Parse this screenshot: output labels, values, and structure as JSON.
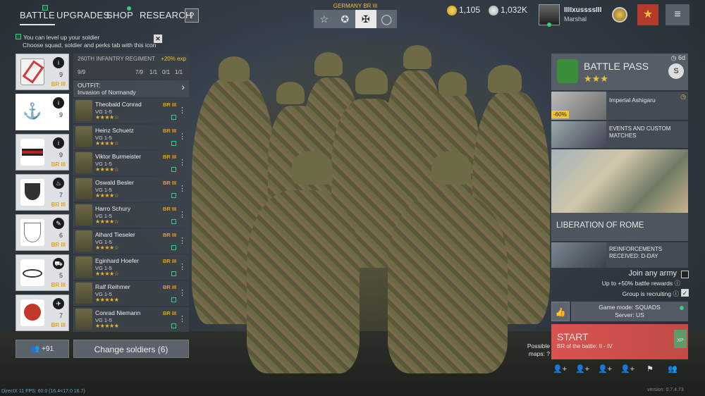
{
  "nav": {
    "tabs": [
      "BATTLE",
      "UPGRADES",
      "SHOP",
      "RESEARCH"
    ],
    "help": "?"
  },
  "nation": {
    "name": "GERMANY",
    "rank": "BR III",
    "icons": [
      "☆",
      "✪",
      "✠",
      "◯"
    ]
  },
  "currency": {
    "gold": "1,105",
    "silver": "1,032K"
  },
  "player": {
    "name": "IIIIxussssIII",
    "rank": "Marshal"
  },
  "hint": {
    "line1": "You can level up your soldier",
    "line2": "Choose squad, soldier and perks tab with this icon",
    "close": "✕"
  },
  "squads": [
    {
      "count": "9",
      "br": "BR III",
      "icon": "i",
      "color": "#d23b3b"
    },
    {
      "count": "9",
      "br": "",
      "icon": "i",
      "color": "#222"
    },
    {
      "count": "9",
      "br": "BR III",
      "icon": "i",
      "color": "#b22"
    },
    {
      "count": "7",
      "br": "BR III",
      "icon": "♨",
      "color": "#333"
    },
    {
      "count": "6",
      "br": "BR III",
      "icon": "✎",
      "color": "#777"
    },
    {
      "count": "5",
      "br": "BR III",
      "icon": "⛟",
      "color": "#555"
    },
    {
      "count": "7",
      "br": "BR III",
      "icon": "✈",
      "color": "#c0392b"
    }
  ],
  "regiment": {
    "title": "260TH INFANTRY REGIMENT",
    "exp": "+20% exp",
    "count": "9/9",
    "slots": [
      "7/9",
      "1/1",
      "0/1",
      "1/1"
    ]
  },
  "outfit": {
    "label": "OUTFIT:",
    "value": "Invasion of Normandy"
  },
  "soldiers": [
    {
      "name": "Theobald Conrad",
      "rank": "VG 1-5",
      "stars": "★★★★☆",
      "br": "BR III"
    },
    {
      "name": "Heinz Schuetz",
      "rank": "VG 1-5",
      "stars": "★★★★☆",
      "br": "BR III"
    },
    {
      "name": "Viktor Burmeister",
      "rank": "VG 1-5",
      "stars": "★★★★☆",
      "br": "BR III"
    },
    {
      "name": "Oswald Besler",
      "rank": "VG 1-5",
      "stars": "★★★★☆",
      "br": "BR III"
    },
    {
      "name": "Harro Schury",
      "rank": "VG 1-5",
      "stars": "★★★★☆",
      "br": "BR III"
    },
    {
      "name": "Alhard Tieseler",
      "rank": "VG 1-5",
      "stars": "★★★★☆",
      "br": "BR III"
    },
    {
      "name": "Eginhard Hoefer",
      "rank": "VG 1-5",
      "stars": "★★★★☆",
      "br": "BR III"
    },
    {
      "name": "Ralf Reihmer",
      "rank": "VG 1-5",
      "stars": "★★★★★",
      "br": "BR III"
    },
    {
      "name": "Conrad Niemann",
      "rank": "VG 1-5",
      "stars": "★★★★★",
      "br": "BR III"
    }
  ],
  "reserve": "+91",
  "change_soldiers": "Change soldiers (6)",
  "battlepass": {
    "title": "BATTLE PASS",
    "stars": "★★★",
    "timer": "6d",
    "badge": "S"
  },
  "events": [
    {
      "title": "Imperial Ashigaru",
      "discount": "-60%"
    },
    {
      "title": "EVENTS AND CUSTOM MATCHES",
      "discount": ""
    }
  ],
  "rome": {
    "title": "LIBERATION OF ROME"
  },
  "reinforcements": {
    "title": "REINFORCEMENTS RECEIVED: D-DAY"
  },
  "join": {
    "title": "Join any army",
    "sub": "Up to +50% battle rewards",
    "group": "Group is recruiting"
  },
  "gamemode": {
    "mode": "Game mode: SQUADS",
    "server": "Server: US"
  },
  "start": {
    "title": "START",
    "sub": "BR of the battle: II - IV",
    "xp": "XP"
  },
  "possible_maps": "Possible maps:",
  "bottom_icons": [
    "👤+",
    "👤+",
    "👤+",
    "👤+",
    "⚑",
    "👥"
  ],
  "version": "version: 0.7.4.73",
  "debug": "DirectX 11 FPS: 60.0 (16.4<17.0 16.7)"
}
